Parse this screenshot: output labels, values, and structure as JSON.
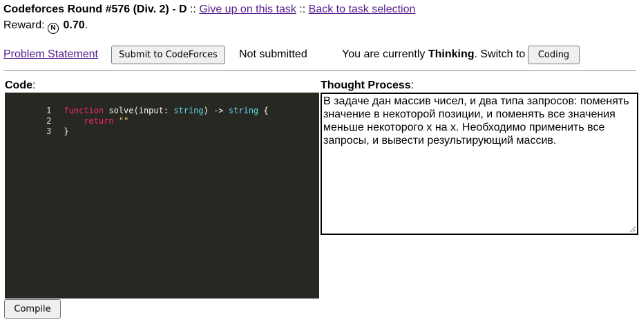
{
  "header": {
    "title": "Codeforces Round #576 (Div. 2) - D",
    "separator": "::",
    "give_up_link": "Give up on this task",
    "back_link": "Back to task selection"
  },
  "reward": {
    "label": "Reward:",
    "coin_symbol": "N",
    "value": "0.70",
    "suffix": "."
  },
  "toolbar": {
    "problem_statement_link": "Problem Statement",
    "submit_button": "Submit to CodeForces",
    "status": "Not submitted",
    "mode_prefix": "You are currently",
    "mode_current": "Thinking",
    "mode_switch_text": ". Switch to",
    "switch_button": "Coding"
  },
  "code_section": {
    "label": "Code",
    "colon": ":",
    "lines": [
      {
        "number": "1"
      },
      {
        "number": "2"
      },
      {
        "number": "3"
      }
    ],
    "tokens": {
      "function_kw": "function",
      "fn_sig_start": " solve(input: ",
      "type_string_1": "string",
      "arrow": ") -> ",
      "type_string_2": "string",
      "brace_open": " {",
      "return_kw": "return",
      "empty_string": "\"\"",
      "brace_close": "}"
    }
  },
  "thought_section": {
    "label": "Thought Process",
    "colon": ":",
    "text": "В задаче дан массив чисел, и два типа запросов: поменять значение в некоторой позиции, и поменять все значения меньше некоторого x на x. Необходимо применить все запросы, и вывести результирующий массив."
  },
  "compile_button": "Compile",
  "colors": {
    "editor_bg": "#272822",
    "keyword": "#f92672",
    "type": "#66d9ef",
    "string": "#e6db74",
    "link": "#551a8b"
  }
}
